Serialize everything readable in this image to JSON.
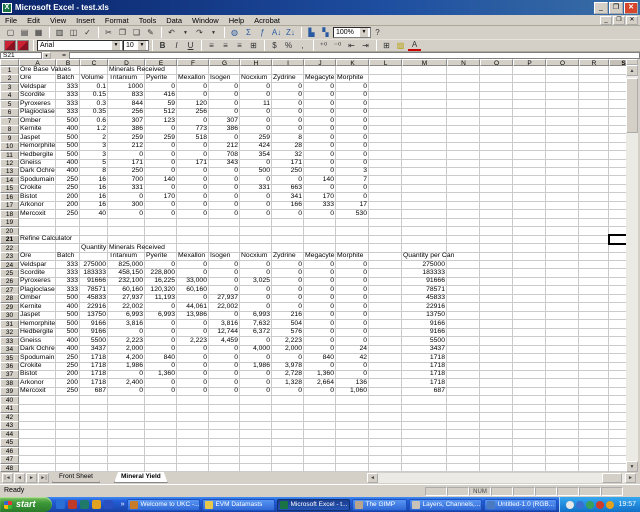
{
  "window": {
    "title": "Microsoft Excel - test.xls"
  },
  "menu": {
    "items": [
      "File",
      "Edit",
      "View",
      "Insert",
      "Format",
      "Tools",
      "Data",
      "Window",
      "Help",
      "Acrobat"
    ]
  },
  "toolbar": {
    "standard_icons": [
      "new-document-icon",
      "open-folder-icon",
      "save-icon",
      "print-icon",
      "print-preview-icon",
      "spelling-icon",
      "cut-icon",
      "copy-icon",
      "paste-icon",
      "format-painter-icon",
      "undo-icon",
      "redo-icon",
      "hyperlink-icon",
      "autosum-icon",
      "paste-function-icon",
      "sort-ascending-icon",
      "sort-descending-icon",
      "chart-wizard-icon",
      "drawing-icon",
      "help-icon"
    ],
    "zoom_value": "100%",
    "font_name": "Arial",
    "font_size": "10",
    "formatting_icons": [
      "bold-icon",
      "italic-icon",
      "underline-icon",
      "align-left-icon",
      "align-center-icon",
      "align-right-icon",
      "merge-center-icon",
      "currency-icon",
      "percent-icon",
      "comma-icon",
      "increase-decimal-icon",
      "decrease-decimal-icon",
      "decrease-indent-icon",
      "increase-indent-icon",
      "borders-icon",
      "fill-color-icon",
      "font-color-icon"
    ]
  },
  "formula_bar": {
    "name_box": "S21",
    "edit_formula_label": "=",
    "formula": ""
  },
  "grid": {
    "column_letters": [
      "A",
      "B",
      "C",
      "D",
      "E",
      "F",
      "G",
      "H",
      "I",
      "J",
      "K",
      "L",
      "M",
      "N",
      "O",
      "P",
      "Q",
      "R",
      "S"
    ],
    "row_count": 48,
    "selected_cell": "S21",
    "selected_column": "S",
    "selected_row": 21
  },
  "sheet": {
    "upper": {
      "row1_label": "Ore Base Values",
      "minerals_label": "Minerals Received",
      "columns": [
        "Ore",
        "Batch",
        "Volume",
        "Tritanium",
        "Pyerite",
        "Mexallon",
        "Isogen",
        "Nocxium",
        "Zydrine",
        "Megacyte",
        "Morphite"
      ],
      "rows": [
        [
          "Veldspar",
          "333",
          "0.1",
          "1000",
          "0",
          "0",
          "0",
          "0",
          "0",
          "0",
          "0"
        ],
        [
          "Scordite",
          "333",
          "0.15",
          "833",
          "416",
          "0",
          "0",
          "0",
          "0",
          "0",
          "0"
        ],
        [
          "Pyroxeres",
          "333",
          "0.3",
          "844",
          "59",
          "120",
          "0",
          "11",
          "0",
          "0",
          "0"
        ],
        [
          "Plagioclase",
          "333",
          "0.35",
          "256",
          "512",
          "256",
          "0",
          "0",
          "0",
          "0",
          "0"
        ],
        [
          "Omber",
          "500",
          "0.6",
          "307",
          "123",
          "0",
          "307",
          "0",
          "0",
          "0",
          "0"
        ],
        [
          "Kernite",
          "400",
          "1.2",
          "386",
          "0",
          "773",
          "386",
          "0",
          "0",
          "0",
          "0"
        ],
        [
          "Jaspet",
          "500",
          "2",
          "259",
          "259",
          "518",
          "0",
          "259",
          "8",
          "0",
          "0"
        ],
        [
          "Hemorphite",
          "500",
          "3",
          "212",
          "0",
          "0",
          "212",
          "424",
          "28",
          "0",
          "0"
        ],
        [
          "Hedbergite",
          "500",
          "3",
          "0",
          "0",
          "0",
          "708",
          "354",
          "32",
          "0",
          "0"
        ],
        [
          "Gneiss",
          "400",
          "5",
          "171",
          "0",
          "171",
          "343",
          "0",
          "171",
          "0",
          "0"
        ],
        [
          "Dark Ochre",
          "400",
          "8",
          "250",
          "0",
          "0",
          "0",
          "500",
          "250",
          "0",
          "3"
        ],
        [
          "Spodumain",
          "250",
          "16",
          "700",
          "140",
          "0",
          "0",
          "0",
          "0",
          "140",
          "7"
        ],
        [
          "Crokite",
          "250",
          "16",
          "331",
          "0",
          "0",
          "0",
          "331",
          "663",
          "0",
          "0"
        ],
        [
          "Bistot",
          "200",
          "16",
          "0",
          "170",
          "0",
          "0",
          "0",
          "341",
          "170",
          "0"
        ],
        [
          "Arkonor",
          "200",
          "16",
          "300",
          "0",
          "0",
          "0",
          "0",
          "166",
          "333",
          "17"
        ],
        [
          "Mercoxit",
          "250",
          "40",
          "0",
          "0",
          "0",
          "0",
          "0",
          "0",
          "0",
          "530"
        ]
      ]
    },
    "lower": {
      "title": "Refine Calculator",
      "quantity_label": "Quantity in",
      "minerals_label": "Minerals Received",
      "qpc_label": "Quantity per Can",
      "columns": [
        "Ore",
        "Batch",
        "",
        "Tritanium",
        "Pyerite",
        "Mexallon",
        "Isogen",
        "Nocxium",
        "Zydrine",
        "Megacyte",
        "Morphite"
      ],
      "rows": [
        [
          "Veldspar",
          "333",
          "275000",
          "825,000",
          "0",
          "0",
          "0",
          "0",
          "0",
          "0",
          "0",
          "275000"
        ],
        [
          "Scordite",
          "333",
          "183333",
          "458,150",
          "228,800",
          "0",
          "0",
          "0",
          "0",
          "0",
          "0",
          "183333"
        ],
        [
          "Pyroxeres",
          "333",
          "91666",
          "232,100",
          "16,225",
          "33,000",
          "0",
          "3,025",
          "0",
          "0",
          "0",
          "91666"
        ],
        [
          "Plagioclase",
          "333",
          "78571",
          "60,160",
          "120,320",
          "60,160",
          "0",
          "0",
          "0",
          "0",
          "0",
          "78571"
        ],
        [
          "Omber",
          "500",
          "45833",
          "27,937",
          "11,193",
          "0",
          "27,937",
          "0",
          "0",
          "0",
          "0",
          "45833"
        ],
        [
          "Kernite",
          "400",
          "22916",
          "22,002",
          "0",
          "44,061",
          "22,002",
          "0",
          "0",
          "0",
          "0",
          "22916"
        ],
        [
          "Jaspet",
          "500",
          "13750",
          "6,993",
          "6,993",
          "13,986",
          "0",
          "6,993",
          "216",
          "0",
          "0",
          "13750"
        ],
        [
          "Hemorphite",
          "500",
          "9166",
          "3,816",
          "0",
          "0",
          "3,816",
          "7,632",
          "504",
          "0",
          "0",
          "9166"
        ],
        [
          "Hedbergite",
          "500",
          "9166",
          "0",
          "0",
          "0",
          "12,744",
          "6,372",
          "576",
          "0",
          "0",
          "9166"
        ],
        [
          "Gneiss",
          "400",
          "5500",
          "2,223",
          "0",
          "2,223",
          "4,459",
          "0",
          "2,223",
          "0",
          "0",
          "5500"
        ],
        [
          "Dark Ochre",
          "400",
          "3437",
          "2,000",
          "0",
          "0",
          "0",
          "4,000",
          "2,000",
          "0",
          "24",
          "3437"
        ],
        [
          "Spodumain",
          "250",
          "1718",
          "4,200",
          "840",
          "0",
          "0",
          "0",
          "0",
          "840",
          "42",
          "1718"
        ],
        [
          "Crokite",
          "250",
          "1718",
          "1,986",
          "0",
          "0",
          "0",
          "1,986",
          "3,978",
          "0",
          "0",
          "1718"
        ],
        [
          "Bistot",
          "200",
          "1718",
          "0",
          "1,360",
          "0",
          "0",
          "0",
          "2,728",
          "1,360",
          "0",
          "1718"
        ],
        [
          "Arkonor",
          "200",
          "1718",
          "2,400",
          "0",
          "0",
          "0",
          "0",
          "1,328",
          "2,664",
          "136",
          "1718"
        ],
        [
          "Mercoxit",
          "250",
          "687",
          "0",
          "0",
          "0",
          "0",
          "0",
          "0",
          "0",
          "1,060",
          "687"
        ]
      ]
    }
  },
  "sheet_tabs": {
    "tabs": [
      "Front Sheet",
      "Mineral Yield"
    ],
    "active": "Mineral Yield"
  },
  "status_bar": {
    "mode": "Ready",
    "num_lock": "NUM"
  },
  "taskbar": {
    "start_label": "start",
    "quick_launch_icons": [
      "browser-icon",
      "red-app-icon",
      "round-app-icon",
      "media-icon",
      "word-icon"
    ],
    "buttons": [
      {
        "label": "Welcome to UKC -...",
        "icon": "welcome-page-icon",
        "active": false
      },
      {
        "label": "EVM Datamasts",
        "icon": "folder-icon",
        "active": false
      },
      {
        "label": "Microsoft Excel - t...",
        "icon": "excel-icon",
        "active": true
      },
      {
        "label": "The GIMP",
        "icon": "gimp-icon",
        "active": false
      },
      {
        "label": "Layers, Channels,...",
        "icon": "gimp-dialog-icon",
        "active": false
      },
      {
        "label": "Untitled-1.0 (RGB...",
        "icon": "image-icon",
        "active": false
      }
    ],
    "tray_icons": [
      "volume-icon",
      "messenger-icon",
      "network-icon",
      "antivirus-icon",
      "update-icon"
    ],
    "clock": "19:57"
  },
  "colors": {
    "title_blue": "#0a246a",
    "taskbar_blue": "#245edb",
    "start_green": "#3c9838",
    "excel_green": "#1a7344",
    "selection_border": "#000000",
    "gridline": "#cbcbcb",
    "chrome_gray": "#d4d0c8"
  }
}
